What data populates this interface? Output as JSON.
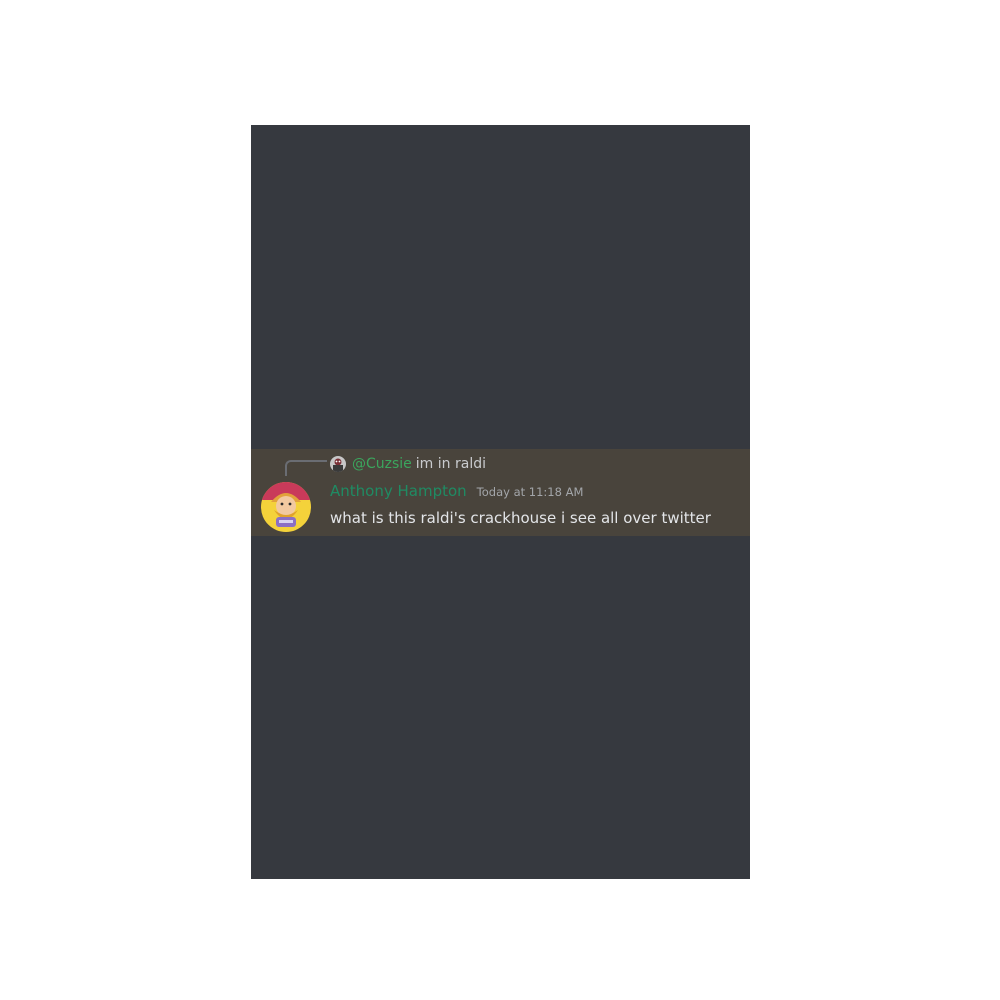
{
  "reply": {
    "mention": "@Cuzsie",
    "text": "im in raldi",
    "avatar_icon": "user-avatar-icon"
  },
  "message": {
    "username": "Anthony Hampton",
    "timestamp": "Today at 11:18 AM",
    "content": "what is this raldi's crackhouse i see all over twitter",
    "avatar_icon": "cartoon-character-avatar-icon"
  },
  "colors": {
    "panel_bg": "#36393f",
    "highlight_bg": "#49443c",
    "mention": "#3ba55d",
    "username": "#1f8b63",
    "timestamp": "#a3a6aa",
    "content": "#e3e5e8"
  }
}
